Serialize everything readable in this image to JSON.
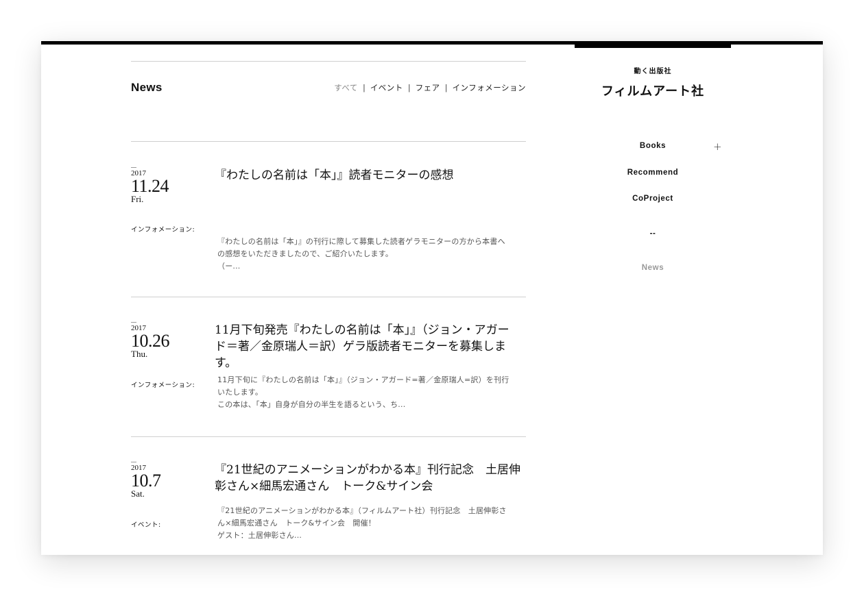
{
  "news": {
    "title": "News",
    "filters": [
      "すべて",
      "イベント",
      "フェア",
      "インフォメーション"
    ],
    "separator": "|"
  },
  "items": [
    {
      "year": "2017",
      "md": "11.24",
      "dow": "Fri.",
      "category": "インフォメーション:",
      "headline": "『わたしの名前は「本」』読者モニターの感想",
      "excerpt_lines": [
        "『わたしの名前は「本」』の刊行に際して募集した読者ゲラモニターの方から本書へ",
        "の感想をいただきましたので、ご紹介いたします。",
        "（ー..."
      ]
    },
    {
      "year": "2017",
      "md": "10.26",
      "dow": "Thu.",
      "category": "インフォメーション:",
      "headline_lines": [
        "11月下旬発売『わたしの名前は「本」』（ジョン・アガー",
        "ド＝著／金原瑞人＝訳）ゲラ版読者モニターを募集しま",
        "す。"
      ],
      "excerpt_lines": [
        "11月下旬に『わたしの名前は「本」』（ジョン・アガード=著／金原瑞人=訳）を刊行",
        "いたします。",
        "この本は、「本」自身が自分の半生を語るという、ち..."
      ]
    },
    {
      "year": "2017",
      "md": "10.7",
      "dow": "Sat.",
      "category": "イベント:",
      "headline_lines": [
        "『21世紀のアニメーションがわかる本』刊行記念　土居伸",
        "彰さん×細馬宏通さん　トーク&サイン会"
      ],
      "excerpt_lines": [
        "『21世紀のアニメーションがわかる本』（フィルムアート社）刊行記念　土居伸彰さ",
        "ん×細馬宏通さん　トーク&サイン会　開催！",
        "ゲスト：土居伸彰さん..."
      ]
    }
  ],
  "sidebar": {
    "tagline": "動く出版社",
    "brand": "フィルムアート社",
    "nav": [
      "Books",
      "Recommend",
      "CoProject",
      "--",
      "News"
    ],
    "expand_symbol": "+"
  }
}
